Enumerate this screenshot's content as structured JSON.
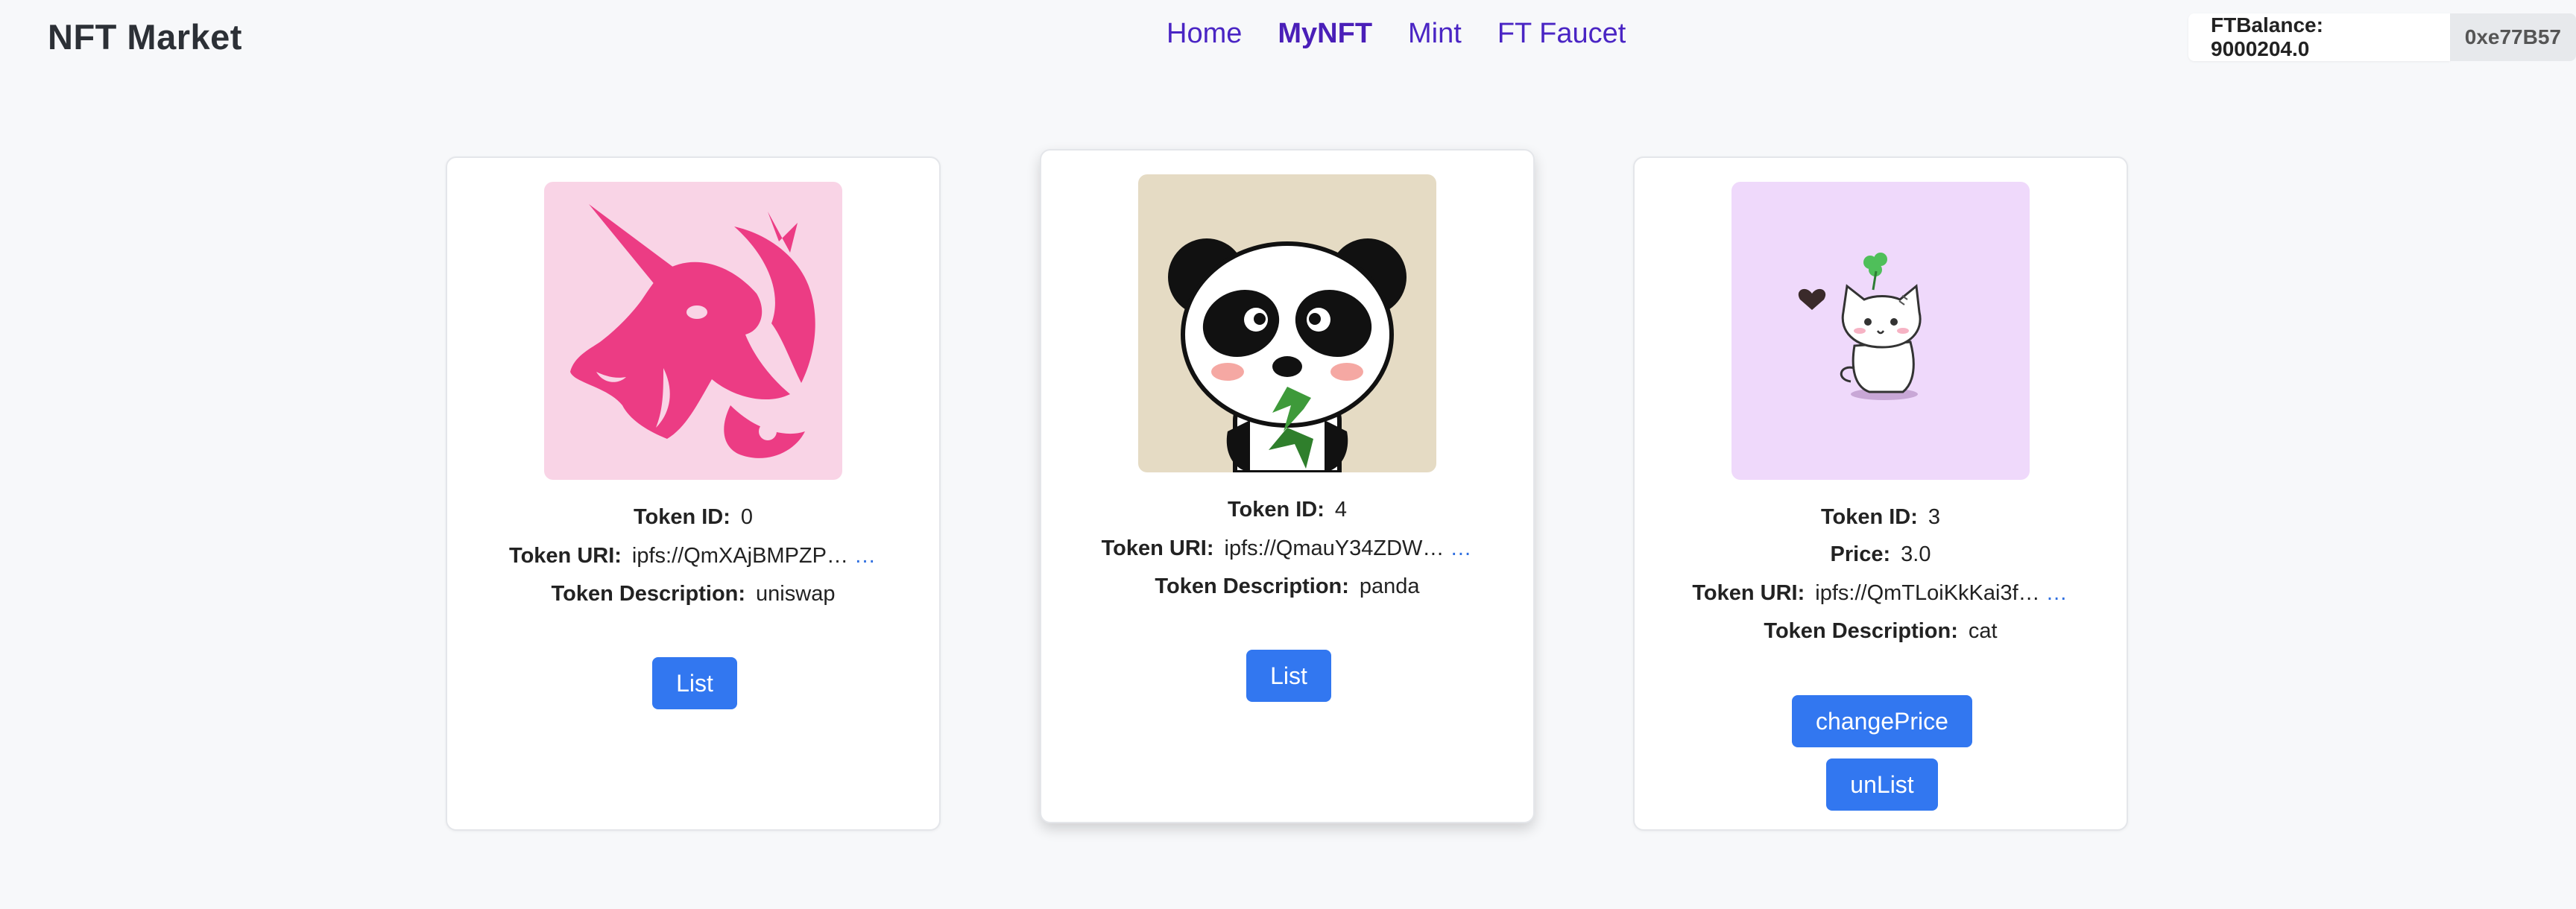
{
  "header": {
    "brand": "NFT Market",
    "nav": [
      {
        "label": "Home",
        "active": false
      },
      {
        "label": "MyNFT",
        "active": true
      },
      {
        "label": "Mint",
        "active": false
      },
      {
        "label": "FT Faucet",
        "active": false
      }
    ],
    "balance": "FTBalance: 9000204.0",
    "address": "0xe77B57"
  },
  "cards": [
    {
      "image": "unicorn-image",
      "image_bg": "#f9d4e6",
      "token_id_label": "Token ID:",
      "token_id": "0",
      "token_uri_label": "Token URI:",
      "token_uri": "ipfs://QmXAjBMPZP…",
      "more": "…",
      "desc_label": "Token Description:",
      "desc": "uniswap",
      "button": "List"
    },
    {
      "image": "panda-image",
      "image_bg": "#e5dbc4",
      "token_id_label": "Token ID:",
      "token_id": "4",
      "token_uri_label": "Token URI:",
      "token_uri": "ipfs://QmauY34ZDW…",
      "more": "…",
      "desc_label": "Token Description:",
      "desc": "panda",
      "button": "List"
    },
    {
      "image": "cat-image",
      "image_bg": "#efd9fb",
      "token_id_label": "Token ID:",
      "token_id": "3",
      "price_label": "Price:",
      "price": "3.0",
      "token_uri_label": "Token URI:",
      "token_uri": "ipfs://QmTLoiKkKai3f…",
      "more": "…",
      "desc_label": "Token Description:",
      "desc": "cat",
      "button_change": "changePrice",
      "button_unlist": "unList"
    }
  ],
  "colors": {
    "accent": "#3277f0",
    "nav": "#4a25c4",
    "unicorn": "#ec3c84"
  }
}
